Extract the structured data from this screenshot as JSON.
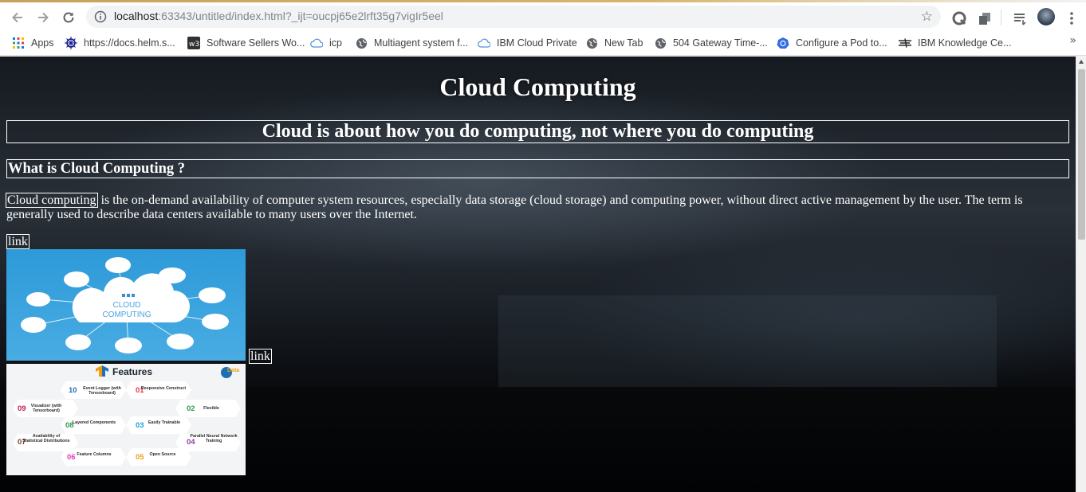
{
  "browser": {
    "url_host": "localhost",
    "url_rest": ":63343/untitled/index.html?_ijt=oucpj65e2lrft35g7vigIr5eel",
    "bookmarks": [
      {
        "label": "Apps",
        "icon": "apps-grid-icon"
      },
      {
        "label": "https://docs.helm.s...",
        "icon": "helm-icon"
      },
      {
        "label": "Software Sellers Wo...",
        "icon": "w3-icon"
      },
      {
        "label": "icp",
        "icon": "cloud-icon"
      },
      {
        "label": "Multiagent system f...",
        "icon": "globe-icon"
      },
      {
        "label": "IBM Cloud Private",
        "icon": "cloud-icon"
      },
      {
        "label": "New Tab",
        "icon": "globe-icon"
      },
      {
        "label": "504 Gateway Time-...",
        "icon": "globe-icon"
      },
      {
        "label": "Configure a Pod to...",
        "icon": "kubernetes-icon"
      },
      {
        "label": "IBM Knowledge Ce...",
        "icon": "ibm-icon"
      }
    ],
    "more_label": "»"
  },
  "page": {
    "title": "Cloud Computing",
    "tagline": "Cloud is about how you do computing, not where you do computing",
    "question": "What is Cloud Computing ?",
    "term": "Cloud computing",
    "paragraph_rest": " is the on-demand availability of computer system resources, especially data storage (cloud storage) and computing power, without direct active management by the user. The term is generally used to describe data centers available to many users over the Internet.",
    "link1": "link",
    "link2": "link",
    "cloud_image": {
      "line1": "CLOUD",
      "line2": "COMPUTING"
    },
    "features_image": {
      "title": "Features",
      "logo_text": "Data",
      "items": [
        {
          "num": "10",
          "label": "Event Logger (with Tensorboard)",
          "color": "#1f6fb5"
        },
        {
          "num": "01",
          "label": "Responsive Construct",
          "color": "#e2364b"
        },
        {
          "num": "09",
          "label": "Visualizer (with Tensorboard)",
          "color": "#c2185b"
        },
        {
          "num": "02",
          "label": "Flexible",
          "color": "#2e9b4f"
        },
        {
          "num": "08",
          "label": "Layered Components",
          "color": "#2e9b4f"
        },
        {
          "num": "03",
          "label": "Easily Trainable",
          "color": "#1ea0d8"
        },
        {
          "num": "07",
          "label": "Availability of Statistical Distributions",
          "color": "#7a3b2e"
        },
        {
          "num": "04",
          "label": "Parallel Neural Network Training",
          "color": "#8e3ca6"
        },
        {
          "num": "06",
          "label": "Feature Columns",
          "color": "#e23ab8"
        },
        {
          "num": "05",
          "label": "Open Source",
          "color": "#e8a21e"
        }
      ]
    }
  }
}
